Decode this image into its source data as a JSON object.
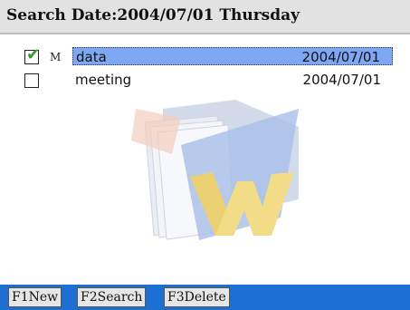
{
  "header": {
    "title": "Search Date:2004/07/01 Thursday"
  },
  "results": [
    {
      "checked": true,
      "mark": "M",
      "name": "data",
      "date": "2004/07/01",
      "selected": true
    },
    {
      "checked": false,
      "mark": "",
      "name": "meeting",
      "date": "2004/07/01",
      "selected": false
    }
  ],
  "softkeys": [
    {
      "label": "F1New"
    },
    {
      "label": "F2Search"
    },
    {
      "label": "F3Delete"
    }
  ],
  "colors": {
    "selection": "#7ea7f4",
    "bottombar": "#1e6fd4",
    "check": "#2e9b2e"
  },
  "watermark": {
    "icon": "folder-w-logo-icon"
  }
}
